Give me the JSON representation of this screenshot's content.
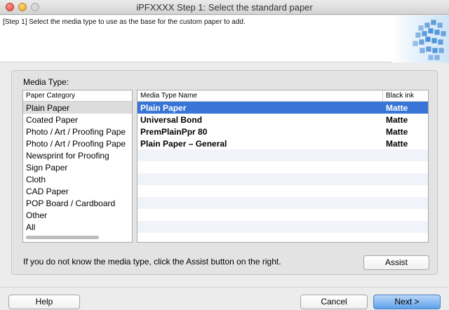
{
  "window": {
    "title": "iPFXXXX Step 1: Select the standard paper"
  },
  "header": {
    "step_text": "[Step 1] Select the media type to use as the base for the custom paper to add.",
    "image_icon": "paper-cubes-icon"
  },
  "media": {
    "label": "Media Type:",
    "category_header": "Paper Category",
    "categories": [
      "Plain Paper",
      "Coated Paper",
      "Photo / Art / Proofing Pape",
      "Photo / Art / Proofing Pape",
      "Newsprint for Proofing",
      "Sign Paper",
      "Cloth",
      "CAD Paper",
      "POP Board / Cardboard",
      "Other",
      "All"
    ],
    "selected_category_index": 0,
    "type_table": {
      "col_name": "Media Type Name",
      "col_ink": "Black ink",
      "rows": [
        {
          "name": "Plain Paper",
          "ink": "Matte"
        },
        {
          "name": "Universal Bond",
          "ink": "Matte"
        },
        {
          "name": "PremPlainPpr 80",
          "ink": "Matte"
        },
        {
          "name": "Plain Paper – General",
          "ink": "Matte"
        }
      ],
      "selected_row_index": 0
    }
  },
  "hint": "If you do not know the media type, click the Assist button on the right.",
  "buttons": {
    "assist": "Assist",
    "help": "Help",
    "cancel": "Cancel",
    "next": "Next >"
  },
  "colors": {
    "selection": "#3875d7",
    "primary_button": "#5ea1ea"
  }
}
